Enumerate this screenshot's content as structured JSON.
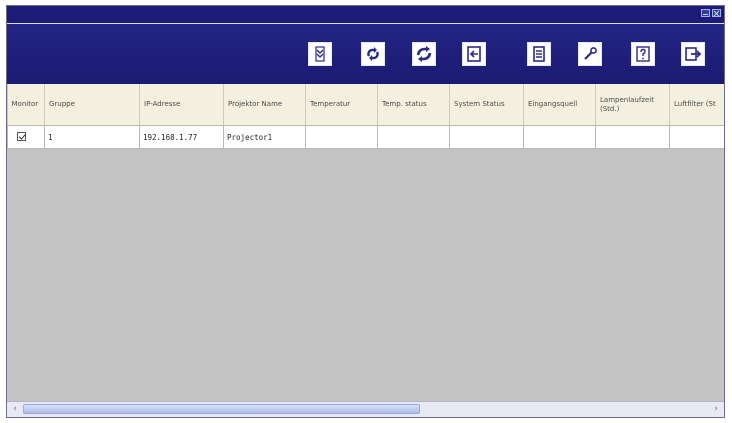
{
  "toolbar": {
    "buttons": [
      {
        "icon": "search-down-icon"
      },
      {
        "icon": "refresh-icon"
      },
      {
        "icon": "reload-icon"
      },
      {
        "icon": "input-select-icon"
      },
      {
        "icon": "log-icon"
      },
      {
        "icon": "settings-icon"
      },
      {
        "icon": "help-icon"
      },
      {
        "icon": "exit-icon"
      }
    ]
  },
  "table": {
    "columns": [
      "Monitor",
      "Gruppe",
      "IP-Adresse",
      "Projektor Name",
      "Temperatur",
      "Temp. status",
      "System Status",
      "Eingangsquell",
      "Lampenlaufzeit (Std.)",
      "Luftfilter (St"
    ],
    "rows": [
      {
        "monitor_checked": true,
        "gruppe": "1",
        "ip": "192.168.1.77",
        "name": "Projector1",
        "temperatur": "",
        "temp_status": "",
        "system_status": "",
        "eingangsquelle": "",
        "lampenlaufzeit": "",
        "luftfilter": ""
      }
    ]
  },
  "scrollbar": {
    "left_arrow": "‹",
    "right_arrow": "›",
    "position": 0.0,
    "visible_fraction": 0.58
  }
}
